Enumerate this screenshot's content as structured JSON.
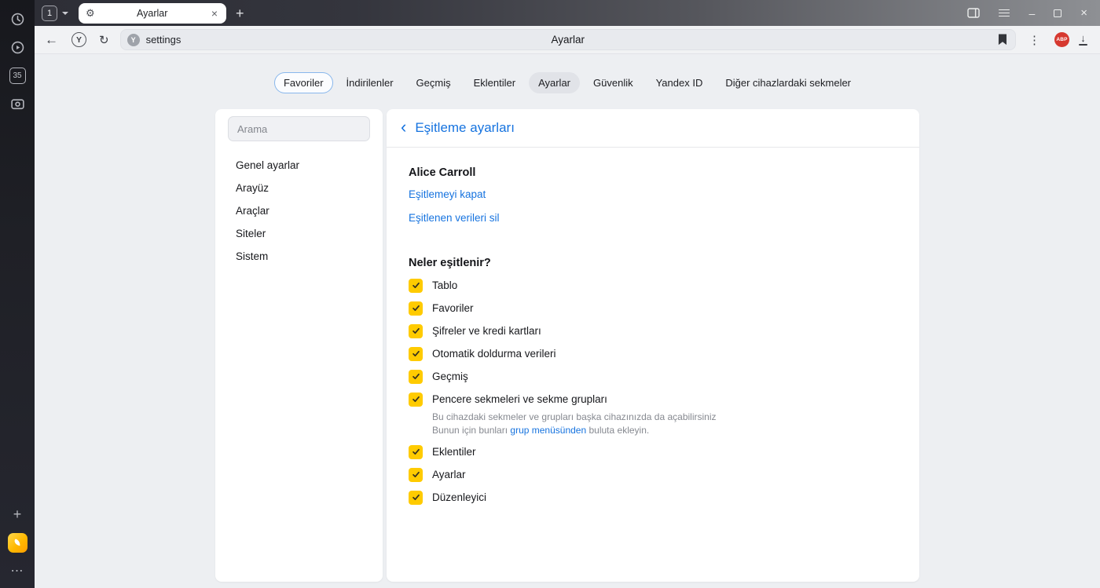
{
  "colors": {
    "accent_blue": "#1673df",
    "checkbox_yellow": "#ffcb00",
    "abp_red": "#d6382f"
  },
  "icons": {
    "back": "←",
    "refresh": "↻",
    "plus": "+",
    "tab_close": "×",
    "kebab": "⋮",
    "ellipsis": "⋯",
    "minimize": "–",
    "window_close": "×",
    "download_arrow": "↓",
    "back_chevron": "‹",
    "gear": "⚙",
    "y_letter": "Y"
  },
  "chrome": {
    "tab_count": "1",
    "tab_title": "Ayarlar",
    "address": "settings",
    "page_title": "Ayarlar",
    "abp_label": "ABP"
  },
  "sidebar": {
    "tab_badge": "35"
  },
  "nav": {
    "tabs": [
      {
        "label": "Favoriler",
        "state": "focused"
      },
      {
        "label": "İndirilenler",
        "state": "normal"
      },
      {
        "label": "Geçmiş",
        "state": "normal"
      },
      {
        "label": "Eklentiler",
        "state": "normal"
      },
      {
        "label": "Ayarlar",
        "state": "selected"
      },
      {
        "label": "Güvenlik",
        "state": "normal"
      },
      {
        "label": "Yandex ID",
        "state": "normal"
      },
      {
        "label": "Diğer cihazlardaki sekmeler",
        "state": "normal"
      }
    ]
  },
  "settings_nav": {
    "search_placeholder": "Arama",
    "items": [
      "Genel ayarlar",
      "Arayüz",
      "Araçlar",
      "Siteler",
      "Sistem"
    ]
  },
  "sync": {
    "title": "Eşitleme ayarları",
    "account": "Alice Carroll",
    "actions": [
      "Eşitlemeyi kapat",
      "Eşitlenen verileri sil"
    ],
    "question": "Neler eşitlenir?",
    "items": [
      {
        "label": "Tablo",
        "checked": true
      },
      {
        "label": "Favoriler",
        "checked": true
      },
      {
        "label": "Şifreler ve kredi kartları",
        "checked": true
      },
      {
        "label": "Otomatik doldurma verileri",
        "checked": true
      },
      {
        "label": "Geçmiş",
        "checked": true
      },
      {
        "label": "Pencere sekmeleri ve sekme grupları",
        "checked": true,
        "desc_line1": "Bu cihazdaki sekmeler ve grupları başka cihazınızda da açabilirsiniz",
        "desc_pre": "Bunun için bunları ",
        "desc_link": "grup menüsünden",
        "desc_post": " buluta ekleyin."
      },
      {
        "label": "Eklentiler",
        "checked": true
      },
      {
        "label": "Ayarlar",
        "checked": true
      },
      {
        "label": "Düzenleyici",
        "checked": true
      }
    ]
  }
}
